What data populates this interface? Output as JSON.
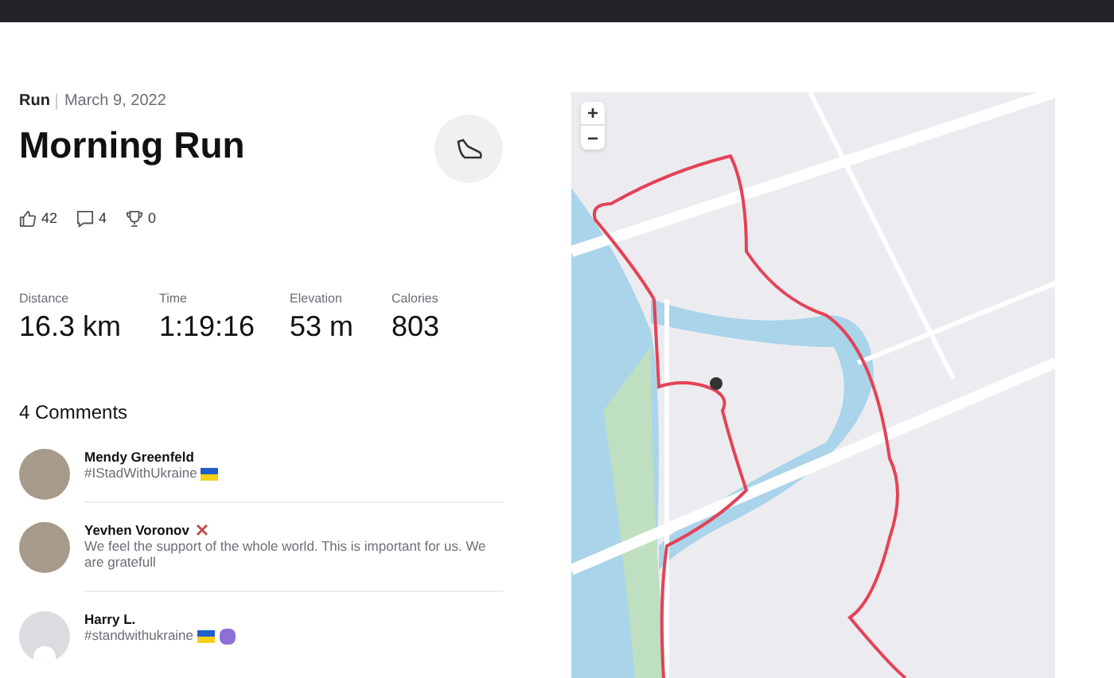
{
  "activity": {
    "type": "Run",
    "date": "March 9, 2022",
    "title": "Morning Run"
  },
  "social": {
    "kudos": "42",
    "comments": "4",
    "achievements": "0"
  },
  "stats": [
    {
      "label": "Distance",
      "value": "16.3 km"
    },
    {
      "label": "Time",
      "value": "1:19:16"
    },
    {
      "label": "Elevation",
      "value": "53 m"
    },
    {
      "label": "Calories",
      "value": "803"
    }
  ],
  "comments_heading": "4 Comments",
  "comments": [
    {
      "name": "Mendy Greenfeld",
      "text": "#IStadWithUkraine",
      "avatar": {
        "kind": "photo"
      },
      "badge": false,
      "icons": [
        {
          "kind": "flag"
        }
      ]
    },
    {
      "name": "Yevhen Voronov",
      "text": "We feel the support of the whole world. This is important for us. We are gratefull",
      "avatar": {
        "kind": "photo"
      },
      "badge": true
    },
    {
      "name": "Harry L.",
      "text": "#standwithukraine",
      "avatar": {
        "kind": "default"
      },
      "badge": false,
      "icons": [
        {
          "kind": "flag"
        },
        {
          "kind": "emoji"
        }
      ]
    }
  ],
  "map": {
    "zoom_in": "+",
    "zoom_out": "−"
  }
}
